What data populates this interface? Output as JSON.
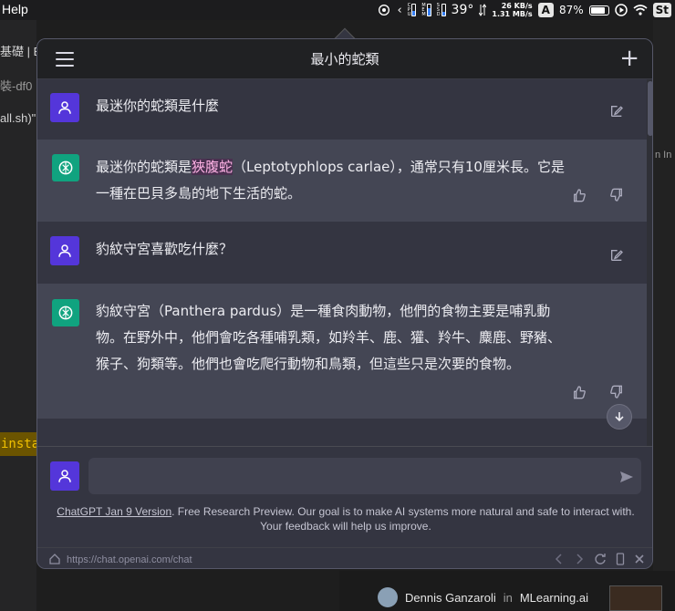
{
  "menubar": {
    "app_menu": "Help",
    "temperature": "39°",
    "net_up": "26 KB/s",
    "net_down": "1.31 MB/s",
    "input_source": "A",
    "battery_percent": "87%",
    "user_initials": "St",
    "meters": [
      {
        "label": "CPU",
        "fill": 0.45
      },
      {
        "label": "MEM",
        "fill": 0.7
      },
      {
        "label": "SSD",
        "fill": 0.35
      }
    ]
  },
  "background": {
    "left_line1": "基礎 | E",
    "left_line2": "裝-df0",
    "left_line3": "all.sh)\"",
    "left_install": "insta",
    "right_fragment": "n In",
    "author_name": "Dennis Ganzaroli",
    "author_in": "in",
    "author_pub": "MLearning.ai"
  },
  "header": {
    "title": "最小的蛇類"
  },
  "messages": [
    {
      "role": "user",
      "text": "最迷你的蛇類是什麼"
    },
    {
      "role": "assistant",
      "text_before": "最迷你的蛇類是",
      "highlight": "狹腹蛇",
      "text_after": "（Leptotyphlops carlae），通常只有10厘米長。它是一種在巴貝多島的地下生活的蛇。"
    },
    {
      "role": "user",
      "text": "豹紋守宮喜歡吃什麼？"
    },
    {
      "role": "assistant",
      "text": "豹紋守宮（Panthera pardus）是一種食肉動物，他們的食物主要是哺乳動物。在野外中，他們會吃各種哺乳類，如羚羊、鹿、獾、羚牛、麋鹿、野豬、猴子、狗類等。他們也會吃爬行動物和鳥類，但這些只是次要的食物。"
    }
  ],
  "composer": {
    "placeholder": "",
    "version_link": "ChatGPT Jan 9 Version",
    "disclaimer": ". Free Research Preview. Our goal is to make AI systems more natural and safe to interact with. Your feedback will help us improve."
  },
  "urlbar": {
    "url": "https://chat.openai.com/chat"
  },
  "colors": {
    "user_avatar": "#5436da",
    "bot_avatar": "#10a37f",
    "assistant_bg": "#444654",
    "user_bg": "#343541"
  }
}
